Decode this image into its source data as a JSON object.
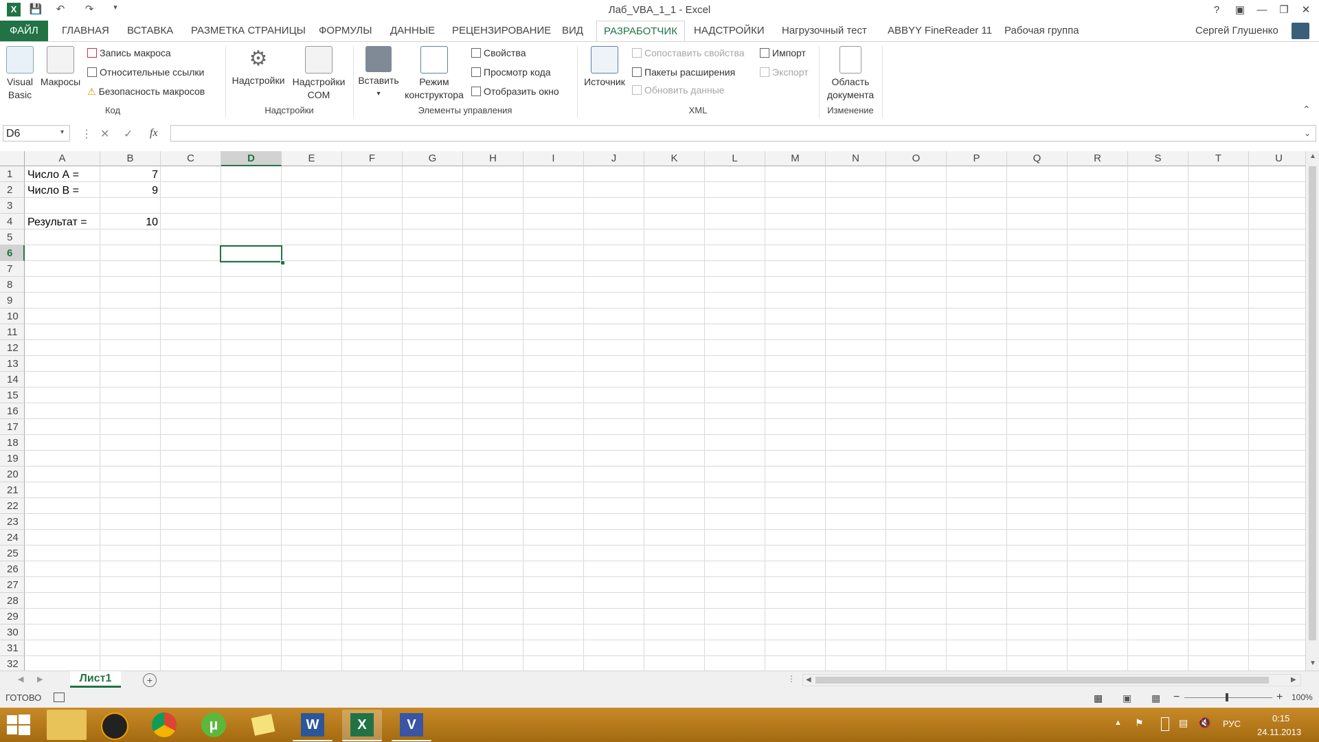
{
  "window": {
    "title": "Лаб_VBA_1_1 - Excel",
    "user": "Сергей Глушенко",
    "help": "?"
  },
  "tabs": [
    {
      "label": "ФАЙЛ"
    },
    {
      "label": "ГЛАВНАЯ"
    },
    {
      "label": "ВСТАВКА"
    },
    {
      "label": "РАЗМЕТКА СТРАНИЦЫ"
    },
    {
      "label": "ФОРМУЛЫ"
    },
    {
      "label": "ДАННЫЕ"
    },
    {
      "label": "РЕЦЕНЗИРОВАНИЕ"
    },
    {
      "label": "ВИД"
    },
    {
      "label": "РАЗРАБОТЧИК"
    },
    {
      "label": "НАДСТРОЙКИ"
    },
    {
      "label": "Нагрузочный тест"
    },
    {
      "label": "ABBYY FineReader 11"
    },
    {
      "label": "Рабочая группа"
    }
  ],
  "ribbon": {
    "code": {
      "label": "Код",
      "visual_basic": "Visual\nBasic",
      "visual_basic_1": "Visual",
      "visual_basic_2": "Basic",
      "macros": "Макросы",
      "record_macro": "Запись макроса",
      "relative_refs": "Относительные ссылки",
      "macro_security": "Безопасность макросов"
    },
    "addins": {
      "label": "Надстройки",
      "addins": "Надстройки",
      "com_1": "Надстройки",
      "com_2": "COM"
    },
    "controls": {
      "label": "Элементы управления",
      "insert": "Вставить",
      "design_1": "Режим",
      "design_2": "конструктора",
      "properties": "Свойства",
      "view_code": "Просмотр кода",
      "show_window": "Отобразить окно"
    },
    "xml": {
      "label": "XML",
      "source": "Источник",
      "map_props": "Сопоставить свойства",
      "expansion_packs": "Пакеты расширения",
      "refresh": "Обновить данные",
      "import": "Импорт",
      "export": "Экспорт"
    },
    "modify": {
      "label": "Изменение",
      "doc_panel_1": "Область",
      "doc_panel_2": "документа"
    }
  },
  "formula_bar": {
    "name_box": "D6",
    "fx": "fx",
    "value": ""
  },
  "columns": [
    "A",
    "B",
    "C",
    "D",
    "E",
    "F",
    "G",
    "H",
    "I",
    "J",
    "K",
    "L",
    "M",
    "N",
    "O",
    "P",
    "Q",
    "R",
    "S",
    "T",
    "U"
  ],
  "rows": [
    "1",
    "2",
    "3",
    "4",
    "5",
    "6",
    "7",
    "8",
    "9",
    "10",
    "11",
    "12",
    "13",
    "14",
    "15",
    "16",
    "17",
    "18",
    "19",
    "20",
    "21",
    "22",
    "23",
    "24",
    "25",
    "26",
    "27",
    "28",
    "29",
    "30",
    "31",
    "32"
  ],
  "cells": {
    "A1": "Число А =",
    "B1": "7",
    "A2": "Число В =",
    "B2": "9",
    "A4": "Результат =",
    "B4": "10"
  },
  "sheets": [
    {
      "label": "Лист1"
    }
  ],
  "status": {
    "mode": "ГОТОВО",
    "zoom": "100%"
  },
  "tray": {
    "lang": "РУС",
    "time": "0:15",
    "date": "24.11.2013"
  },
  "colors": {
    "accent": "#217346",
    "taskbar": "#b67a1c"
  }
}
